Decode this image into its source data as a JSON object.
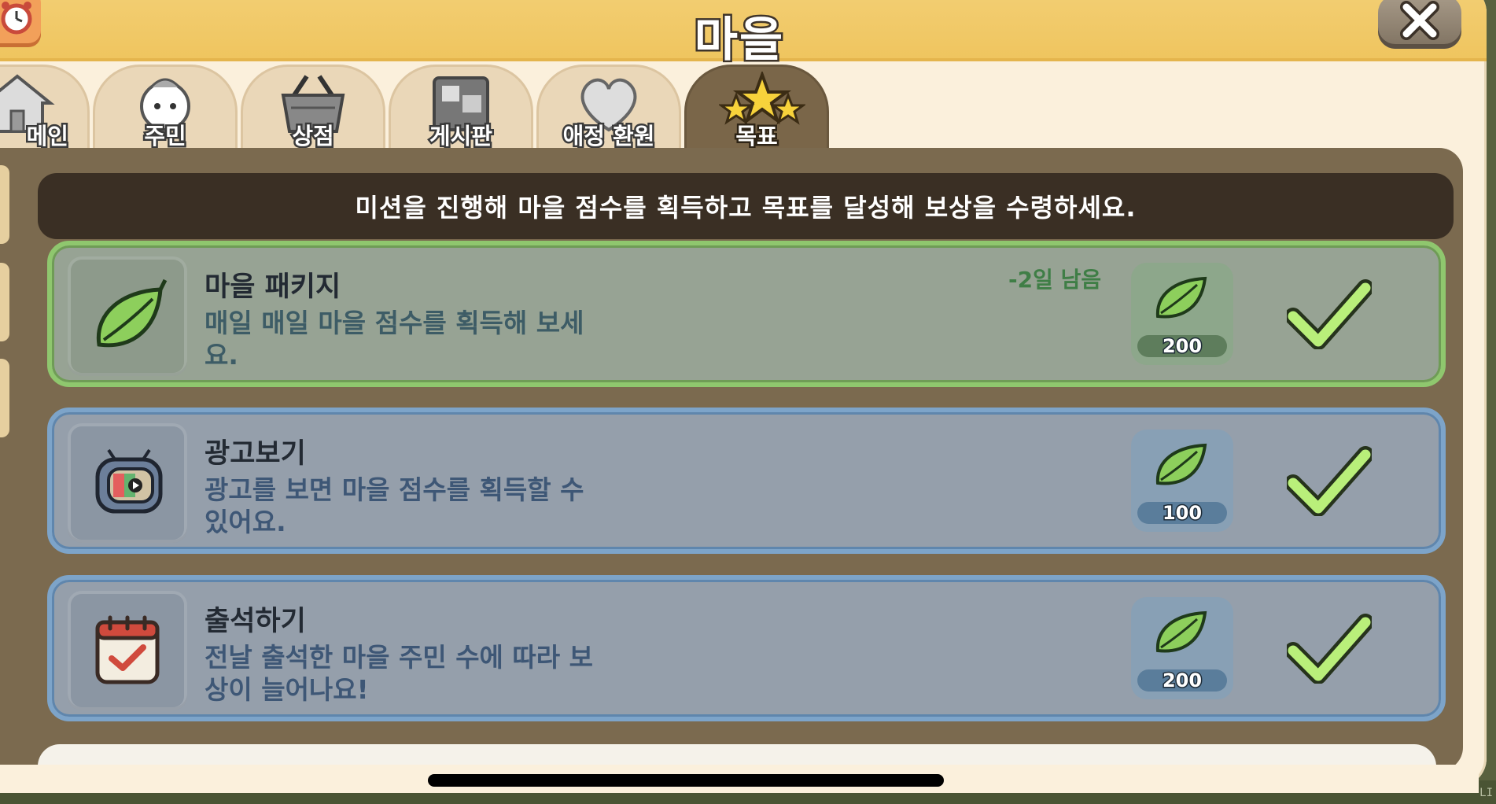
{
  "window": {
    "title": "마을",
    "alarm_icon": "alarm-clock-icon",
    "close_icon": "close-x-icon"
  },
  "tabs": [
    {
      "label": "메인",
      "icon": "house-icon",
      "active": false
    },
    {
      "label": "주민",
      "icon": "villager-icon",
      "active": false
    },
    {
      "label": "상점",
      "icon": "basket-icon",
      "active": false
    },
    {
      "label": "게시판",
      "icon": "board-icon",
      "active": false
    },
    {
      "label": "애정 환원",
      "icon": "heart-icon",
      "active": false
    },
    {
      "label": "목표",
      "icon": "stars-icon",
      "active": true
    }
  ],
  "banner_text": "미션을 진행해 마을 점수를 획득하고 목표를 달성해 보상을 수령하세요.",
  "missions": [
    {
      "title": "마을 패키지",
      "description": "매일 매일 마을 점수를 획득해 보세요.",
      "days_left": "-2일 남음",
      "reward": "200",
      "icon": "leaf-icon",
      "completed": true
    },
    {
      "title": "광고보기",
      "description": "광고를 보면 마을 점수를 획득할 수 있어요.",
      "days_left": "",
      "reward": "100",
      "icon": "tv-icon",
      "completed": true
    },
    {
      "title": "출석하기",
      "description": "전날 출석한 마을 주민 수에 따라 보상이 늘어나요!",
      "days_left": "",
      "reward": "200",
      "icon": "calendar-check-icon",
      "completed": true
    }
  ],
  "colors": {
    "titlebar": "#efc55f",
    "panel": "#7b6a4f",
    "banner": "#3a2f24",
    "green_card_border": "#8fc76e",
    "blue_card_border": "#7da4c9",
    "check": "#b9ef7a"
  },
  "background_label": "LI"
}
